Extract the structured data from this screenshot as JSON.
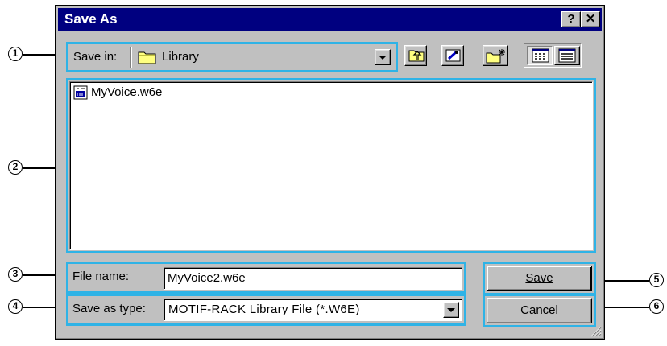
{
  "dialog": {
    "title": "Save As",
    "help_glyph": "?",
    "close_glyph": "✕"
  },
  "save_in": {
    "label": "Save in:",
    "value": "Library"
  },
  "toolbar": {
    "icons": [
      "up-one-level-icon",
      "desktop-icon",
      "create-new-folder-icon",
      "list-view-icon",
      "details-view-icon"
    ]
  },
  "files": [
    {
      "name": "MyVoice.w6e",
      "icon": "voice-file-icon"
    }
  ],
  "file_name": {
    "label": "File name:",
    "value": "MyVoice2.w6e"
  },
  "save_as_type": {
    "label": "Save as type:",
    "value": "MOTIF-RACK Library File (*.W6E)"
  },
  "buttons": {
    "save": "Save",
    "cancel": "Cancel"
  },
  "callouts": [
    "1",
    "2",
    "3",
    "4",
    "5",
    "6"
  ],
  "colors": {
    "highlight": "#2fb3e6",
    "title_bar": "#000080",
    "face": "#c0c0c0"
  }
}
